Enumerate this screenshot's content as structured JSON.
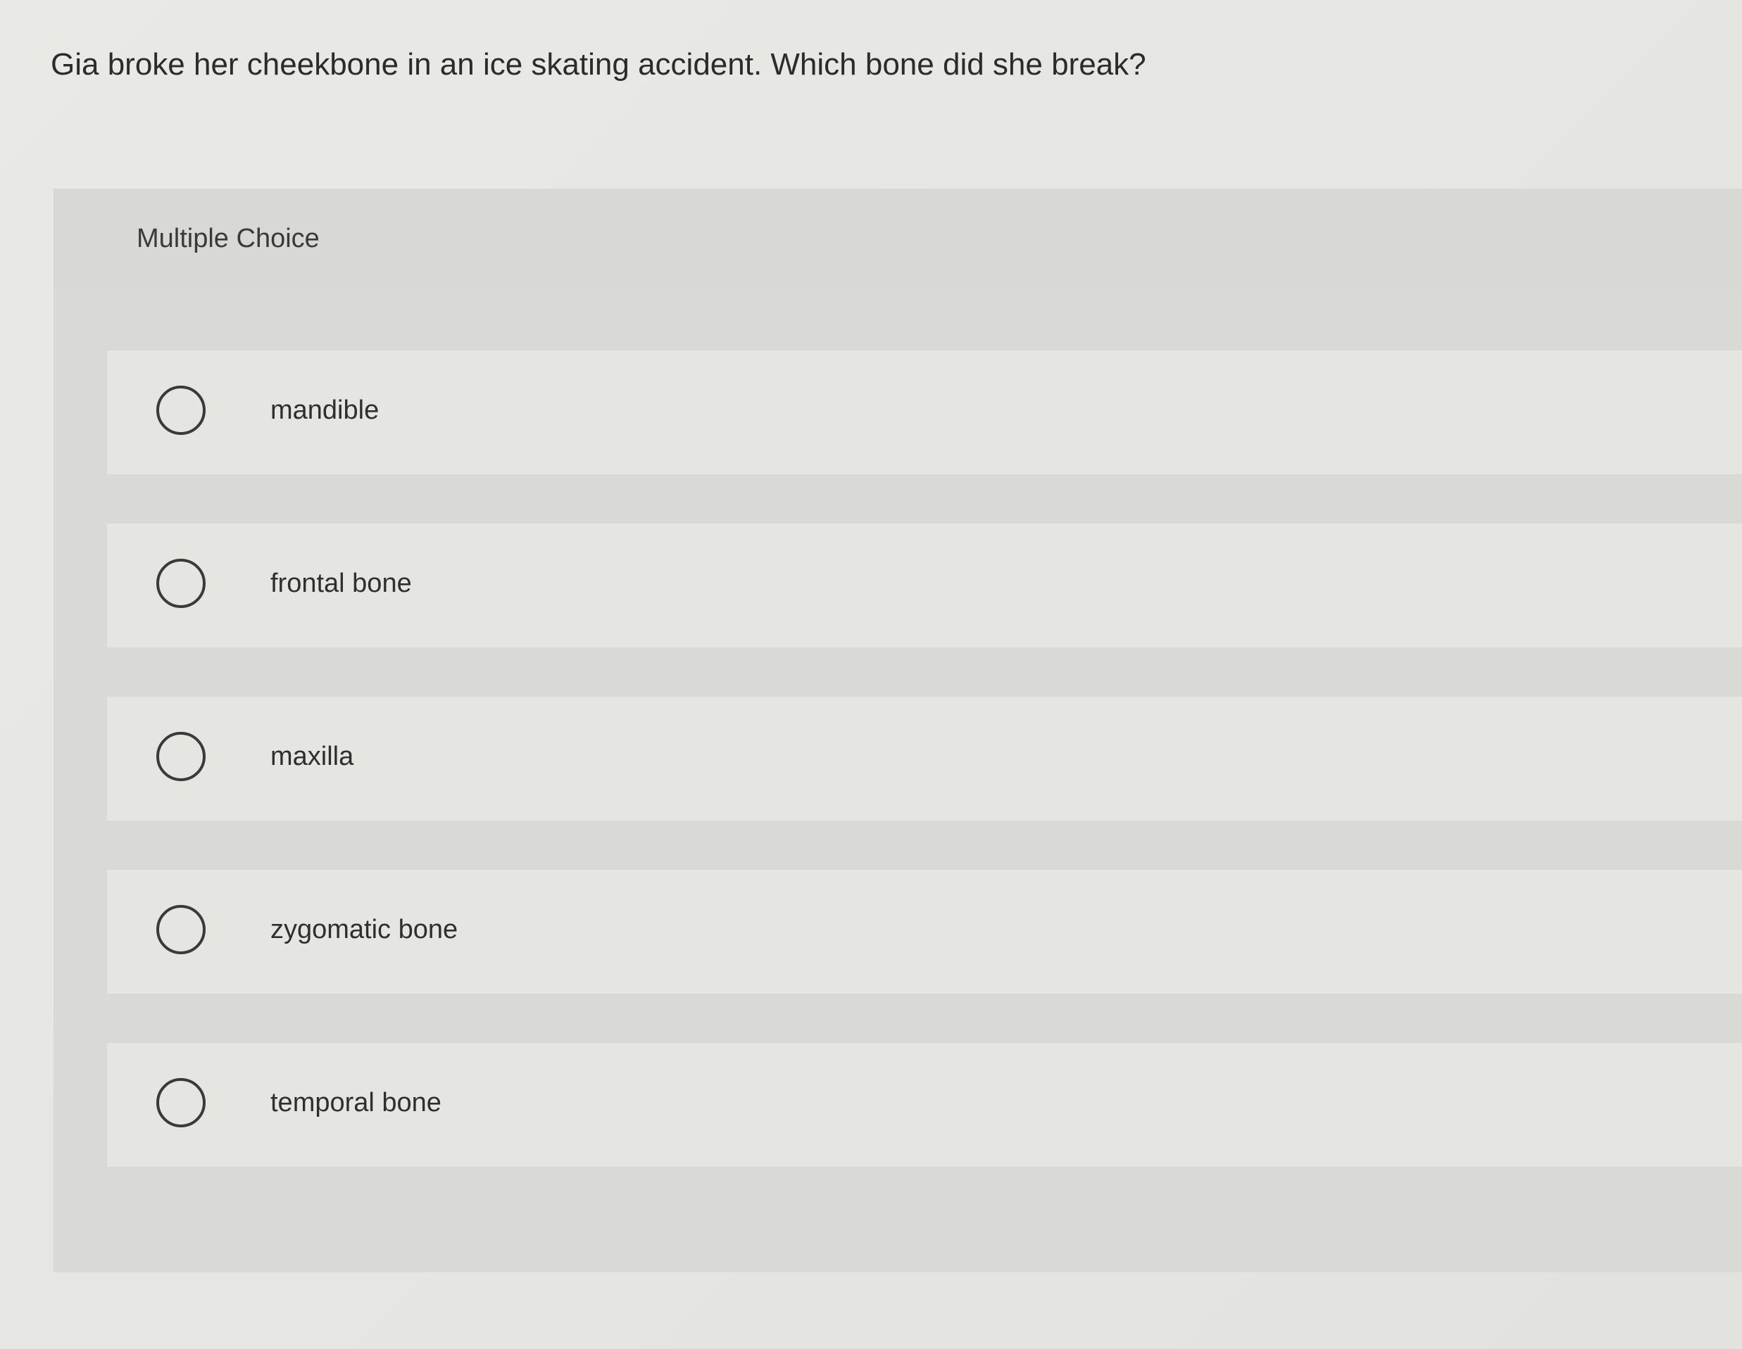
{
  "question": {
    "text": "Gia broke her cheekbone in an ice skating accident. Which bone did she break?"
  },
  "panel": {
    "label": "Multiple Choice"
  },
  "choices": [
    {
      "label": "mandible",
      "selected": false
    },
    {
      "label": "frontal bone",
      "selected": false
    },
    {
      "label": "maxilla",
      "selected": false
    },
    {
      "label": "zygomatic bone",
      "selected": false
    },
    {
      "label": "temporal bone",
      "selected": false
    }
  ],
  "colors": {
    "background": "#e6e6e2",
    "panel": "#d9d9d5",
    "choice_row": "#e5e5e1",
    "text": "#2e2e2e",
    "radio_border": "#3a3a3a"
  },
  "icons": {
    "radio": "radio-unchecked-icon"
  }
}
